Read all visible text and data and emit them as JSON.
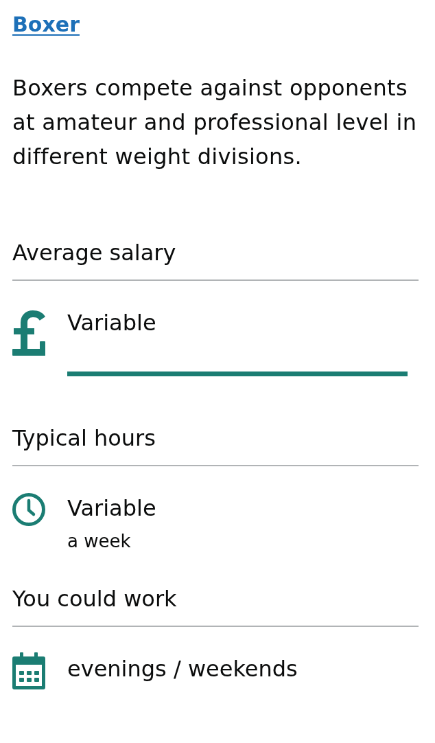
{
  "title": {
    "text": "Boxer"
  },
  "summary": "Boxers compete against opponents at amateur and professional level in different weight divisions.",
  "sections": [
    {
      "heading": "Average salary",
      "kind": "salary",
      "value": "Variable"
    },
    {
      "heading": "Typical hours",
      "kind": "hours",
      "value": "Variable",
      "unit": "a week"
    },
    {
      "heading": "You could work",
      "kind": "schedule",
      "value": "evenings / weekends"
    }
  ]
}
